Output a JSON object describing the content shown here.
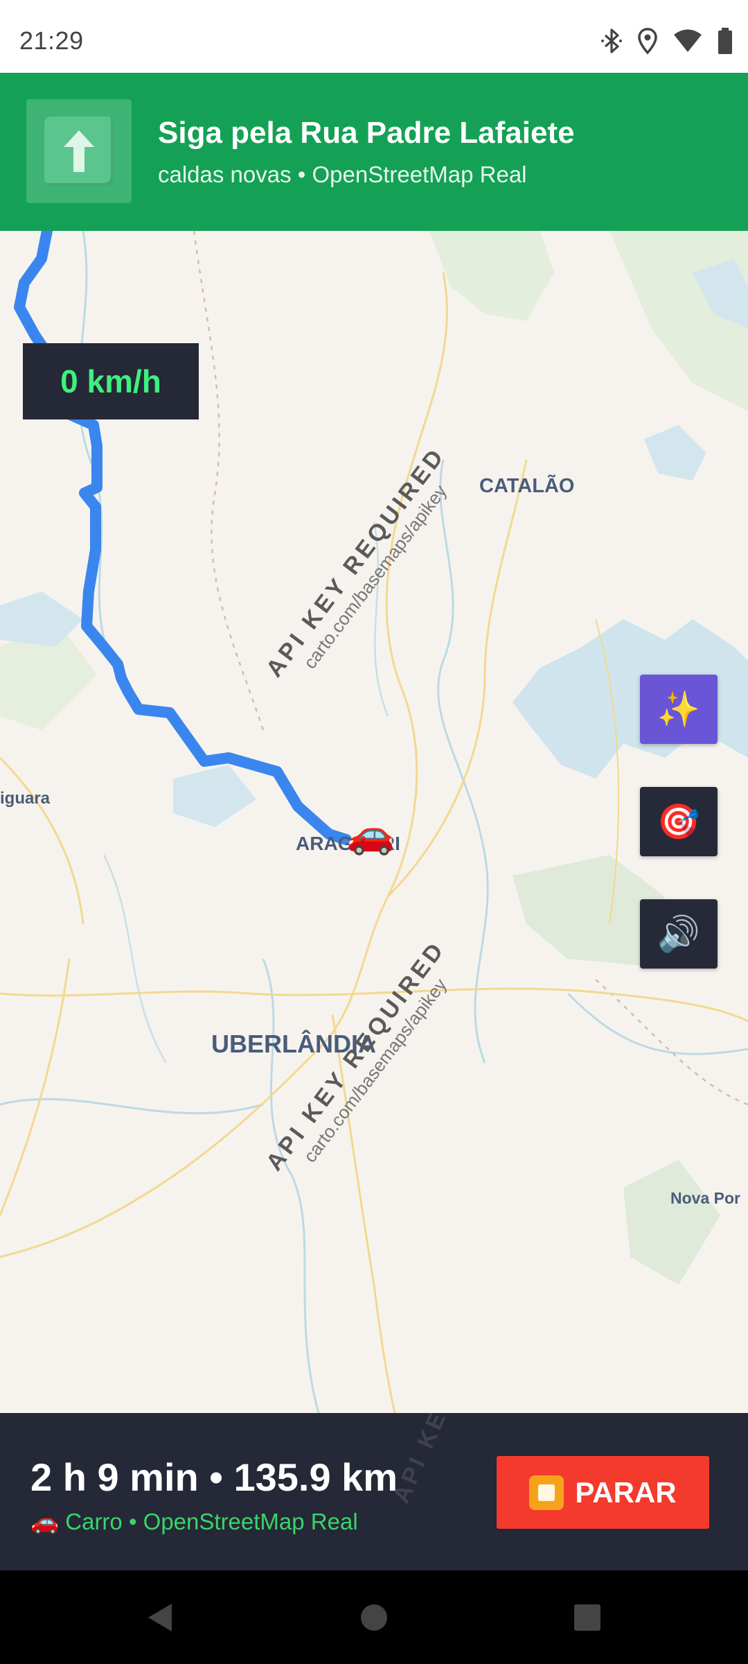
{
  "status_bar": {
    "time": "21:29",
    "icons": [
      "bluetooth-icon",
      "location-icon",
      "wifi-icon",
      "battery-icon"
    ]
  },
  "navigation": {
    "maneuver_icon": "arrow-up-icon",
    "instruction": "Siga pela Rua Padre Lafaiete",
    "subtitle": "caldas novas • OpenStreetMap Real",
    "color": "#14a155"
  },
  "map": {
    "speed": "0 km/h",
    "places": {
      "catalao": "CATALÃO",
      "araguari": "ARAGUARI",
      "uberlandia": "UBERLÂNDIA",
      "iguara": "iguara",
      "nova_ponte": "Nova Por"
    },
    "watermark": {
      "main": "API KEY REQUIRED",
      "sub": "carto.com/basemaps/apikey"
    },
    "route_color": "#3a86ee",
    "vehicle_icon": "🚗",
    "controls": {
      "magic": "✨",
      "target": "🎯",
      "sound": "🔊"
    }
  },
  "trip": {
    "eta": "2 h 9 min • 135.9 km",
    "mode": "🚗 Carro • OpenStreetMap Real",
    "stop_icon": "stop-icon",
    "stop_label": "PARAR",
    "stop_color": "#f33a2d"
  },
  "system_nav": {
    "icons": [
      "back-icon",
      "home-icon",
      "recents-icon"
    ]
  }
}
